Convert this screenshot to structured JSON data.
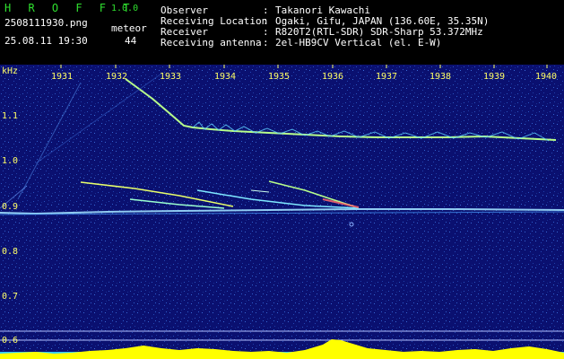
{
  "header": {
    "app_name": "H R O F F T",
    "version": "1.0.0",
    "filename": "2508111930.png",
    "datetime": "25.08.11 19:30",
    "meteor_label": "meteor",
    "meteor_count": "44",
    "info": [
      {
        "label": "Observer",
        "value": "Takanori Kawachi"
      },
      {
        "label": "Receiving Location",
        "value": "Ogaki, Gifu, JAPAN (136.60E, 35.35N)"
      },
      {
        "label": "Receiver",
        "value": "R820T2(RTL-SDR) SDR-Sharp 53.372MHz"
      },
      {
        "label": "Receiving antenna",
        "value": "2el-HB9CV Vertical (el. E-W)"
      }
    ]
  },
  "spectrogram": {
    "unit": "kHz",
    "y_ticks": [
      "1.1",
      "1.0",
      "0.9",
      "0.8",
      "0.7",
      "0.6"
    ],
    "x_ticks": [
      "1931",
      "1932",
      "1933",
      "1934",
      "1935",
      "1936",
      "1937",
      "1938",
      "1939",
      "1940"
    ],
    "colors": {
      "background": "#0a1070",
      "carrier": "#9fe0ff",
      "trail": "#e8ff6a",
      "level": "#ffff00",
      "level_base": "#33ccff"
    }
  }
}
